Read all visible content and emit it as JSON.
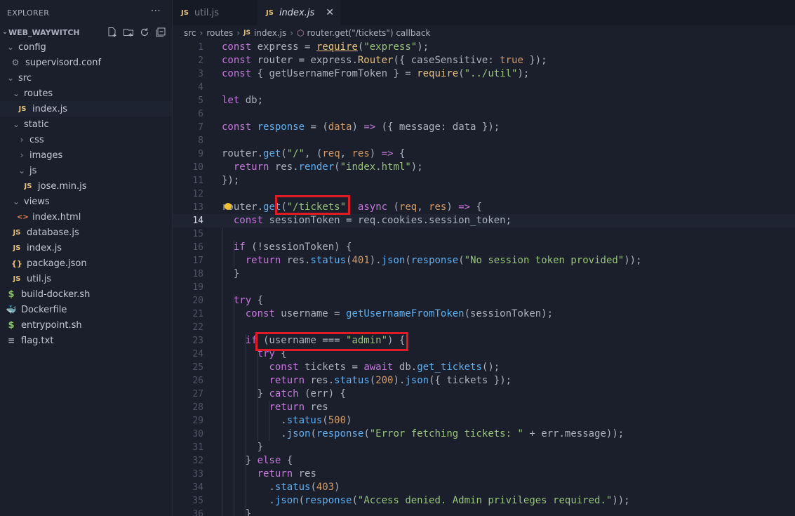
{
  "sidebar": {
    "title": "EXPLORER",
    "more": "···",
    "project": "WEB_WAYWITCH",
    "tree": [
      {
        "label": "config",
        "kind": "folder-open"
      },
      {
        "label": "supervisord.conf",
        "kind": "gear"
      },
      {
        "label": "src",
        "kind": "folder-open"
      },
      {
        "label": "routes",
        "kind": "folder-open"
      },
      {
        "label": "index.js",
        "kind": "js",
        "active": true
      },
      {
        "label": "static",
        "kind": "folder-open"
      },
      {
        "label": "css",
        "kind": "folder-closed"
      },
      {
        "label": "images",
        "kind": "folder-closed"
      },
      {
        "label": "js",
        "kind": "folder-open"
      },
      {
        "label": "jose.min.js",
        "kind": "js"
      },
      {
        "label": "views",
        "kind": "folder-open"
      },
      {
        "label": "index.html",
        "kind": "html"
      },
      {
        "label": "database.js",
        "kind": "js"
      },
      {
        "label": "index.js",
        "kind": "js"
      },
      {
        "label": "package.json",
        "kind": "json"
      },
      {
        "label": "util.js",
        "kind": "js"
      },
      {
        "label": "build-docker.sh",
        "kind": "sh"
      },
      {
        "label": "Dockerfile",
        "kind": "docker"
      },
      {
        "label": "entrypoint.sh",
        "kind": "sh"
      },
      {
        "label": "flag.txt",
        "kind": "txt"
      }
    ]
  },
  "tabs": [
    {
      "icon": "JS",
      "label": "util.js",
      "active": false
    },
    {
      "icon": "JS",
      "label": "index.js",
      "active": true,
      "close": "✕"
    }
  ],
  "breadcrumb": {
    "parts": [
      "src",
      "routes",
      "index.js"
    ],
    "symbol": "router.get(\"/tickets\") callback",
    "icon": "JS"
  },
  "editor": {
    "current_line": 14,
    "lines": [
      {
        "n": "1",
        "tokens": [
          [
            "k",
            "const"
          ],
          [
            "p",
            " express = "
          ],
          [
            "f ul",
            "require"
          ],
          [
            "p",
            "("
          ],
          [
            "s",
            "\"express\""
          ],
          [
            "p",
            ");"
          ]
        ]
      },
      {
        "n": "2",
        "tokens": [
          [
            "k",
            "const"
          ],
          [
            "p",
            " router = express."
          ],
          [
            "f",
            "Router"
          ],
          [
            "p",
            "({ caseSensitive: "
          ],
          [
            "v",
            "true"
          ],
          [
            "p",
            " });"
          ]
        ]
      },
      {
        "n": "3",
        "tokens": [
          [
            "k",
            "const"
          ],
          [
            "p",
            " { getUsernameFromToken } = "
          ],
          [
            "f",
            "require"
          ],
          [
            "p",
            "("
          ],
          [
            "s",
            "\"../util\""
          ],
          [
            "p",
            ");"
          ]
        ]
      },
      {
        "n": "4",
        "tokens": []
      },
      {
        "n": "5",
        "tokens": [
          [
            "k",
            "let"
          ],
          [
            "p",
            " db;"
          ]
        ]
      },
      {
        "n": "6",
        "tokens": []
      },
      {
        "n": "7",
        "tokens": [
          [
            "k",
            "const"
          ],
          [
            "p",
            " "
          ],
          [
            "fn",
            "response"
          ],
          [
            "p",
            " = ("
          ],
          [
            "v",
            "data"
          ],
          [
            "p",
            ") "
          ],
          [
            "k",
            "=>"
          ],
          [
            "p",
            " ({ message: data });"
          ]
        ]
      },
      {
        "n": "8",
        "tokens": []
      },
      {
        "n": "9",
        "tokens": [
          [
            "p",
            "router."
          ],
          [
            "fn",
            "get"
          ],
          [
            "p",
            "("
          ],
          [
            "s",
            "\"/\""
          ],
          [
            "p",
            ", ("
          ],
          [
            "v",
            "req"
          ],
          [
            "p",
            ", "
          ],
          [
            "v",
            "res"
          ],
          [
            "p",
            ") "
          ],
          [
            "k",
            "=>"
          ],
          [
            "p",
            " {"
          ]
        ]
      },
      {
        "n": "10",
        "tokens": [
          [
            "p",
            "  "
          ],
          [
            "k",
            "return"
          ],
          [
            "p",
            " res."
          ],
          [
            "fn",
            "render"
          ],
          [
            "p",
            "("
          ],
          [
            "s",
            "\"index.html\""
          ],
          [
            "p",
            ");"
          ]
        ]
      },
      {
        "n": "11",
        "tokens": [
          [
            "p",
            "});"
          ]
        ]
      },
      {
        "n": "12",
        "tokens": []
      },
      {
        "n": "13",
        "tokens": [
          [
            "p",
            "router."
          ],
          [
            "fn",
            "get"
          ],
          [
            "p",
            "("
          ],
          [
            "s",
            "\"/tickets\""
          ],
          [
            "p",
            ", "
          ],
          [
            "k",
            "async"
          ],
          [
            "p",
            " ("
          ],
          [
            "v",
            "req"
          ],
          [
            "p",
            ", "
          ],
          [
            "v",
            "res"
          ],
          [
            "p",
            ") "
          ],
          [
            "k",
            "=>"
          ],
          [
            "p",
            " {"
          ]
        ]
      },
      {
        "n": "14",
        "tokens": [
          [
            "p",
            "  "
          ],
          [
            "k",
            "const"
          ],
          [
            "p",
            " sessionToken = req.cookies.session_token;"
          ]
        ]
      },
      {
        "n": "15",
        "tokens": []
      },
      {
        "n": "16",
        "tokens": [
          [
            "p",
            "  "
          ],
          [
            "k",
            "if"
          ],
          [
            "p",
            " (!sessionToken) {"
          ]
        ]
      },
      {
        "n": "17",
        "tokens": [
          [
            "p",
            "    "
          ],
          [
            "k",
            "return"
          ],
          [
            "p",
            " res."
          ],
          [
            "fn",
            "status"
          ],
          [
            "p",
            "("
          ],
          [
            "n",
            "401"
          ],
          [
            "p",
            ")."
          ],
          [
            "fn",
            "json"
          ],
          [
            "p",
            "("
          ],
          [
            "fn",
            "response"
          ],
          [
            "p",
            "("
          ],
          [
            "s",
            "\"No session token provided\""
          ],
          [
            "p",
            "));"
          ]
        ]
      },
      {
        "n": "18",
        "tokens": [
          [
            "p",
            "  }"
          ]
        ]
      },
      {
        "n": "19",
        "tokens": []
      },
      {
        "n": "20",
        "tokens": [
          [
            "p",
            "  "
          ],
          [
            "k",
            "try"
          ],
          [
            "p",
            " {"
          ]
        ]
      },
      {
        "n": "21",
        "tokens": [
          [
            "p",
            "    "
          ],
          [
            "k",
            "const"
          ],
          [
            "p",
            " username = "
          ],
          [
            "fn",
            "getUsernameFromToken"
          ],
          [
            "p",
            "(sessionToken);"
          ]
        ]
      },
      {
        "n": "22",
        "tokens": []
      },
      {
        "n": "23",
        "tokens": [
          [
            "p",
            "    "
          ],
          [
            "k",
            "if"
          ],
          [
            "p",
            " (username === "
          ],
          [
            "s",
            "\"admin\""
          ],
          [
            "p",
            ") {"
          ]
        ]
      },
      {
        "n": "24",
        "tokens": [
          [
            "p",
            "      "
          ],
          [
            "k",
            "try"
          ],
          [
            "p",
            " {"
          ]
        ]
      },
      {
        "n": "25",
        "tokens": [
          [
            "p",
            "        "
          ],
          [
            "k",
            "const"
          ],
          [
            "p",
            " tickets = "
          ],
          [
            "k",
            "await"
          ],
          [
            "p",
            " db."
          ],
          [
            "fn",
            "get_tickets"
          ],
          [
            "p",
            "();"
          ]
        ]
      },
      {
        "n": "26",
        "tokens": [
          [
            "p",
            "        "
          ],
          [
            "k",
            "return"
          ],
          [
            "p",
            " res."
          ],
          [
            "fn",
            "status"
          ],
          [
            "p",
            "("
          ],
          [
            "n",
            "200"
          ],
          [
            "p",
            ")."
          ],
          [
            "fn",
            "json"
          ],
          [
            "p",
            "({ tickets });"
          ]
        ]
      },
      {
        "n": "27",
        "tokens": [
          [
            "p",
            "      } "
          ],
          [
            "k",
            "catch"
          ],
          [
            "p",
            " (err) {"
          ]
        ]
      },
      {
        "n": "28",
        "tokens": [
          [
            "p",
            "        "
          ],
          [
            "k",
            "return"
          ],
          [
            "p",
            " res"
          ]
        ]
      },
      {
        "n": "29",
        "tokens": [
          [
            "p",
            "          ."
          ],
          [
            "fn",
            "status"
          ],
          [
            "p",
            "("
          ],
          [
            "n",
            "500"
          ],
          [
            "p",
            ")"
          ]
        ]
      },
      {
        "n": "30",
        "tokens": [
          [
            "p",
            "          ."
          ],
          [
            "fn",
            "json"
          ],
          [
            "p",
            "("
          ],
          [
            "fn",
            "response"
          ],
          [
            "p",
            "("
          ],
          [
            "s",
            "\"Error fetching tickets: \""
          ],
          [
            "p",
            " + err.message));"
          ]
        ]
      },
      {
        "n": "31",
        "tokens": [
          [
            "p",
            "      }"
          ]
        ]
      },
      {
        "n": "32",
        "tokens": [
          [
            "p",
            "    } "
          ],
          [
            "k",
            "else"
          ],
          [
            "p",
            " {"
          ]
        ]
      },
      {
        "n": "33",
        "tokens": [
          [
            "p",
            "      "
          ],
          [
            "k",
            "return"
          ],
          [
            "p",
            " res"
          ]
        ]
      },
      {
        "n": "34",
        "tokens": [
          [
            "p",
            "        ."
          ],
          [
            "fn",
            "status"
          ],
          [
            "p",
            "("
          ],
          [
            "n",
            "403"
          ],
          [
            "p",
            ")"
          ]
        ]
      },
      {
        "n": "35",
        "tokens": [
          [
            "p",
            "        ."
          ],
          [
            "fn",
            "json"
          ],
          [
            "p",
            "("
          ],
          [
            "fn",
            "response"
          ],
          [
            "p",
            "("
          ],
          [
            "s",
            "\"Access denied. Admin privileges required.\""
          ],
          [
            "p",
            "));"
          ]
        ]
      },
      {
        "n": "36",
        "tokens": [
          [
            "p",
            "    }"
          ]
        ]
      }
    ]
  },
  "colors": {
    "background": "#1b1f2b",
    "highlight_box": "#e01b24",
    "keyword": "#c678dd",
    "string": "#98c379",
    "function": "#61afef"
  }
}
